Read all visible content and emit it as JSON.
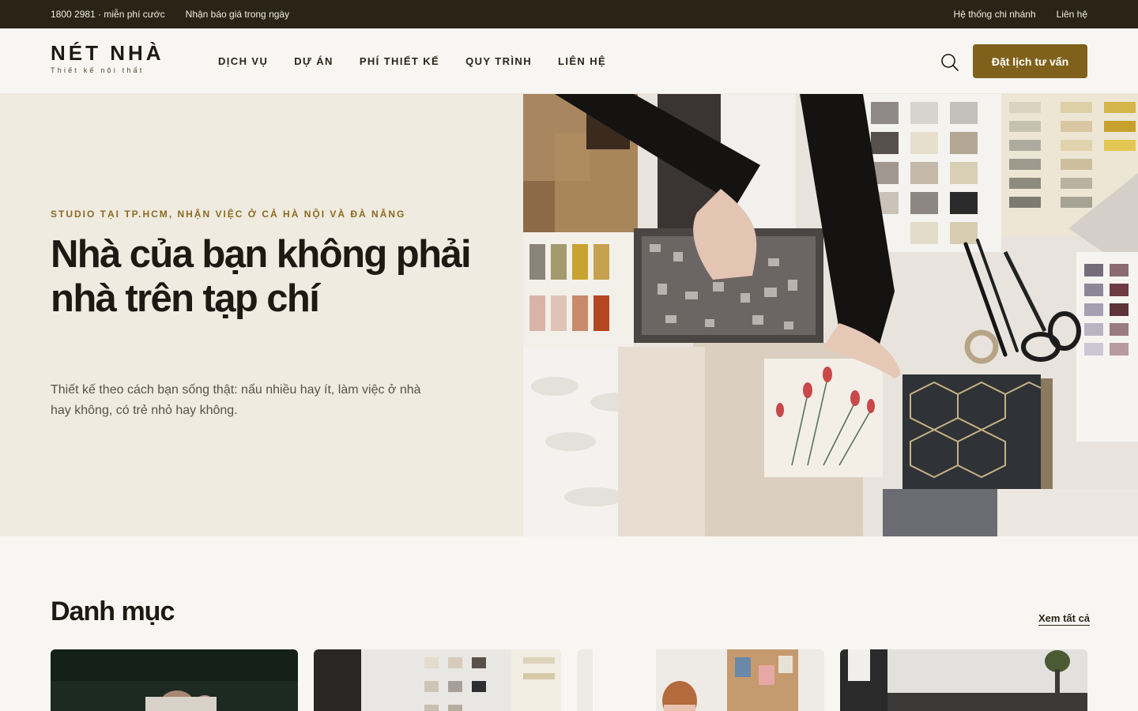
{
  "topbar": {
    "phone": "1800 2981 · miễn phí cước",
    "quote": "Nhận báo giá trong ngày",
    "branches": "Hệ thống chi nhánh",
    "contact": "Liên hệ"
  },
  "brand": {
    "name": "NÉT NHÀ",
    "tagline": "Thiết kế nội thất"
  },
  "nav": {
    "items": [
      {
        "label": "DỊCH VỤ"
      },
      {
        "label": "DỰ ÁN"
      },
      {
        "label": "PHÍ THIẾT KẾ"
      },
      {
        "label": "QUY TRÌNH"
      },
      {
        "label": "LIÊN HỆ"
      }
    ],
    "search_icon": "search-icon",
    "cta_label": "Đặt lịch tư vấn"
  },
  "hero": {
    "eyebrow": "STUDIO TẠI TP.HCM, NHẬN VIỆC Ở CẢ HÀ NỘI VÀ ĐÀ NẴNG",
    "title": "Nhà của bạn không phải nhà trên tạp chí",
    "subtitle": "Thiết kế theo cách bạn sống thật: nấu nhiều hay ít, làm việc ở nhà hay không, có trẻ nhỏ hay không."
  },
  "categories": {
    "title": "Danh mục",
    "see_all": "Xem tất cả"
  },
  "colors": {
    "topbar": "#2b2416",
    "accent": "#7f611c",
    "eyebrow": "#8b6a20",
    "hero_bg": "#efebe1",
    "page_bg": "#f8f6f2"
  }
}
